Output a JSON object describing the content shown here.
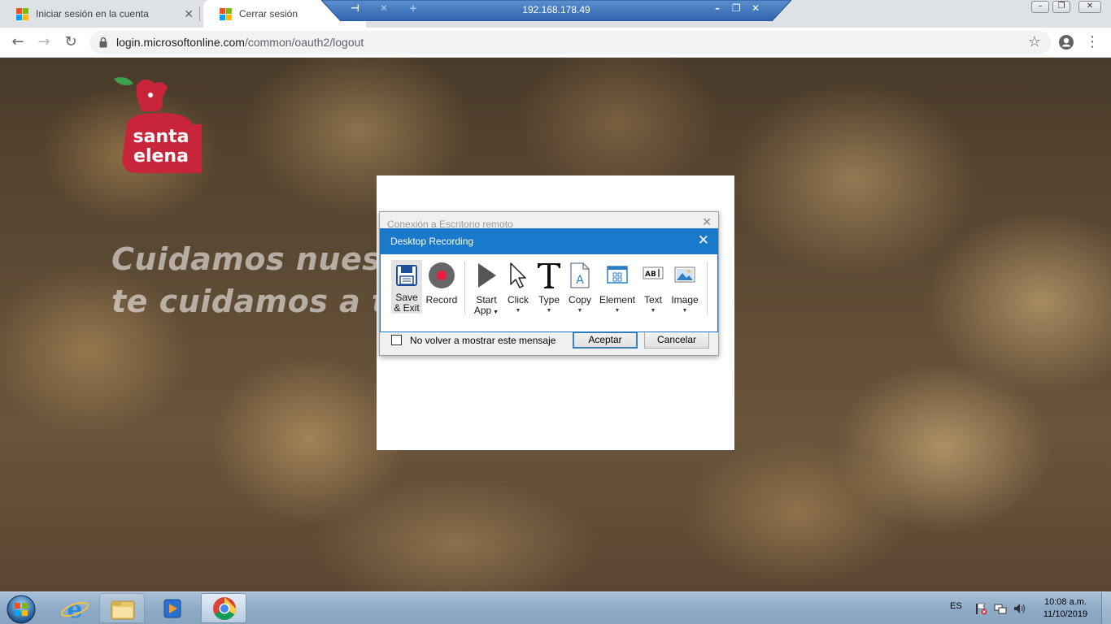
{
  "browser": {
    "tabs": [
      {
        "title": "Iniciar sesión en la cuenta",
        "close": "✕"
      },
      {
        "title": "Cerrar sesión"
      }
    ],
    "url_host": "login.microsoftonline.com",
    "url_path": "/common/oauth2/logout"
  },
  "rdp_bar": {
    "ip": "192.168.178.49"
  },
  "page": {
    "slogan_line1": "Cuidamos nuestro",
    "slogan_line2": "te cuidamos a ti",
    "logo_text_1": "santa",
    "logo_text_2": "elena"
  },
  "rdp_dialog": {
    "title": "Conexión a Escritorio remoto",
    "checkbox_label": "No volver a mostrar este mensaje",
    "accept": "Aceptar",
    "cancel": "Cancelar"
  },
  "recorder": {
    "title": "Desktop Recording",
    "tools": {
      "save_1": "Save",
      "save_2": "& Exit",
      "record": "Record",
      "start_1": "Start",
      "start_2": "App",
      "click": "Click",
      "type": "Type",
      "copy": "Copy",
      "element": "Element",
      "text": "Text",
      "image": "Image"
    }
  },
  "taskbar": {
    "lang": "ES",
    "time": "10:08 a.m.",
    "date": "11/10/2019"
  },
  "colors": {
    "recorder_blue": "#1979ca",
    "brand_red": "#c8243a"
  }
}
